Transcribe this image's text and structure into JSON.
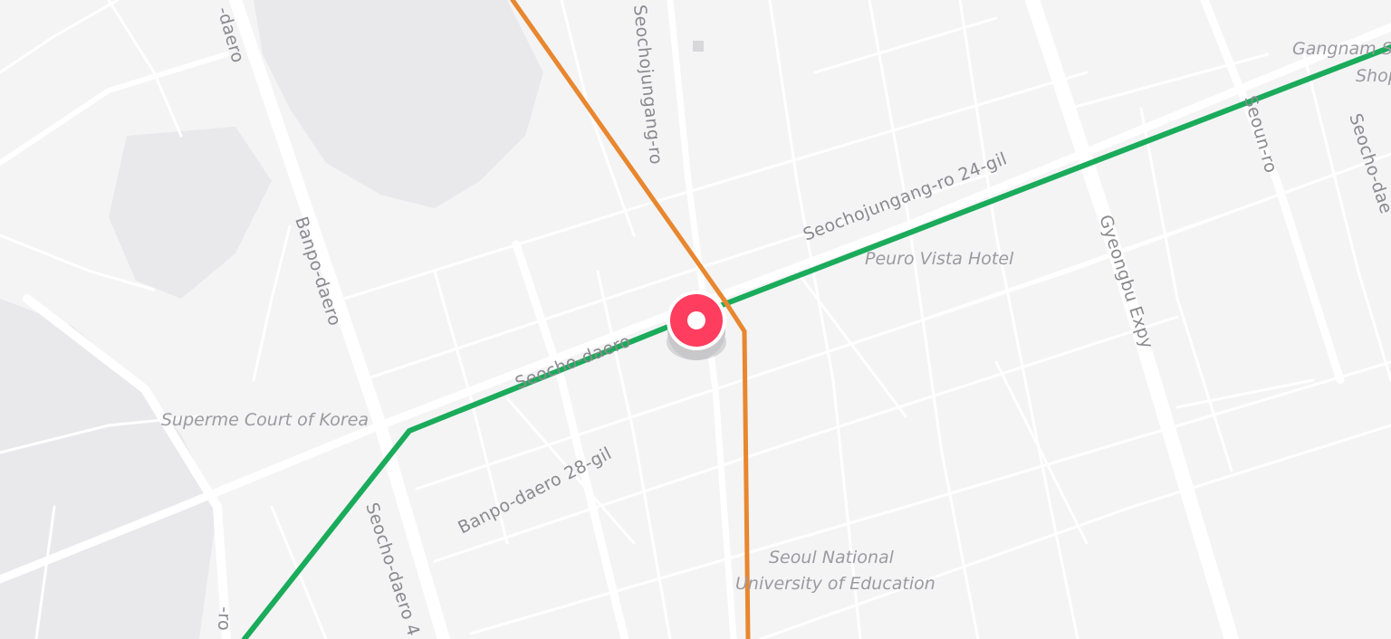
{
  "map": {
    "road_labels": {
      "seochojungang_ro": "Seochojungang-ro",
      "seochojungang_ro_24_gil": "Seochojungang-ro 24-gil",
      "banpo_daero": "Banpo-daero",
      "banpo_daero_top": "-daero",
      "seocho_daero": "Seocho-daero",
      "banpo_daero_28_gil": "Banpo-daero 28-gil",
      "seocho_daero_4x": "Seocho-daero 4",
      "gyeongbu_expy": "Gyeongbu Expy",
      "seoun_ro": "Seoun-ro",
      "seocho_daero_right": "Seocho-dae",
      "bottom_ro": "-ro"
    },
    "poi_labels": {
      "supreme_court": "Superme Court of Korea",
      "peuro_vista_hotel": "Peuro Vista Hotel",
      "seoul_national_line1": "Seoul National",
      "seoul_national_line2": "University of Education",
      "gangnam_line1": "Gangnam S",
      "gangnam_line2": "Shop"
    },
    "transit_lines": [
      {
        "name": "line-green",
        "color": "#1aab5b"
      },
      {
        "name": "line-orange",
        "color": "#e8872f"
      }
    ],
    "marker": {
      "icon": "location-pin-icon",
      "color": "#ff3d5f"
    }
  }
}
